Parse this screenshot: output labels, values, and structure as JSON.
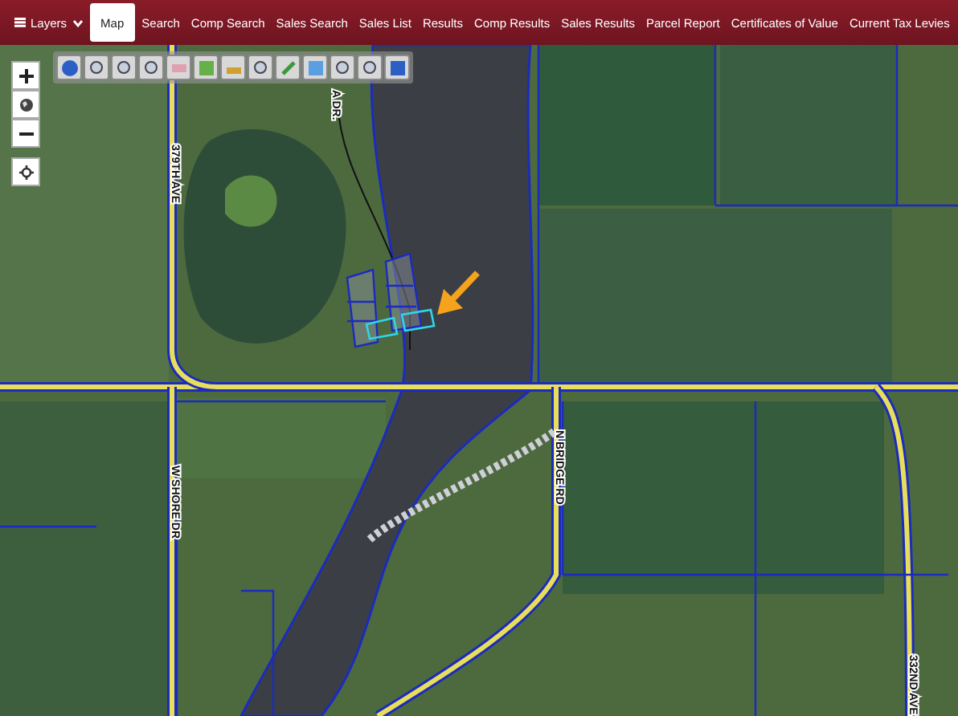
{
  "nav": {
    "layers": {
      "label": "Layers",
      "expanded": false
    },
    "tabs": [
      {
        "label": "Map",
        "selected": true
      },
      {
        "label": "Search",
        "selected": false
      },
      {
        "label": "Comp Search",
        "selected": false
      },
      {
        "label": "Sales Search",
        "selected": false
      },
      {
        "label": "Sales List",
        "selected": false
      },
      {
        "label": "Results",
        "selected": false
      },
      {
        "label": "Comp Results",
        "selected": false
      },
      {
        "label": "Sales Results",
        "selected": false
      },
      {
        "label": "Parcel Report",
        "selected": false
      },
      {
        "label": "Certificates of Value",
        "selected": false
      },
      {
        "label": "Current Tax Levies",
        "selected": false
      }
    ]
  },
  "map": {
    "road_labels": [
      "379TH AVE",
      "A DR.",
      "W SHORE DR",
      "N BRIDGE RD",
      "332ND AVE"
    ]
  }
}
